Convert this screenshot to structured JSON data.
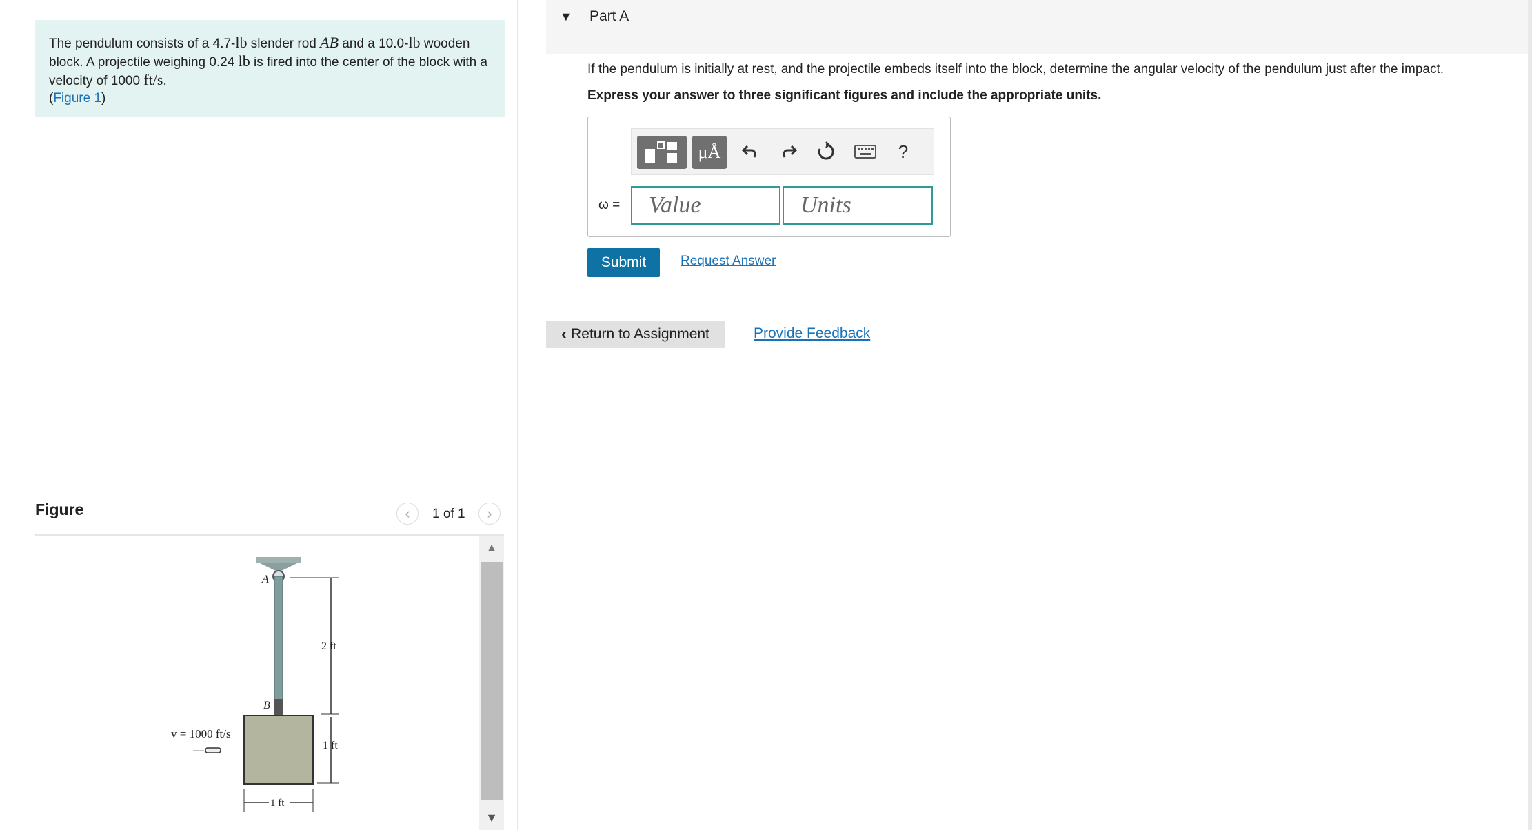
{
  "problem": {
    "part1": "The pendulum consists of a 4.7-",
    "lb": "lb",
    "part2": " slender rod ",
    "rod": "AB",
    "part3": " and a 10.0-",
    "part4": " wooden block. A projectile weighing 0.24 ",
    "part5": " is fired into the center of the block with a velocity of 1000 ",
    "velocity_unit": "ft/s",
    "period": ".",
    "figure_link": "Figure 1"
  },
  "figure": {
    "heading": "Figure",
    "count": "1 of 1",
    "label_a": "A",
    "label_b": "B",
    "dim_rod": "2 ft",
    "dim_block_height": "1 ft",
    "dim_block_width": "1 ft",
    "velocity": "v = 1000 ft/s"
  },
  "part": {
    "title": "Part A",
    "question": "If the pendulum is initially at rest, and the projectile embeds itself into the block, determine the angular velocity of the pendulum just after the impact.",
    "instructions": "Express your answer to three significant figures and include the appropriate units."
  },
  "answer": {
    "label": "ω =",
    "value_placeholder": "Value",
    "units_placeholder": "Units",
    "units_button": "μÅ",
    "help": "?"
  },
  "buttons": {
    "submit": "Submit",
    "request_answer": "Request Answer",
    "return": "Return to Assignment",
    "feedback": "Provide Feedback"
  },
  "colors": {
    "problem_bg": "#e3f3f1",
    "submit_bg": "#0f72a5",
    "link": "#1a73b8",
    "field_border": "#2f9a9a"
  }
}
